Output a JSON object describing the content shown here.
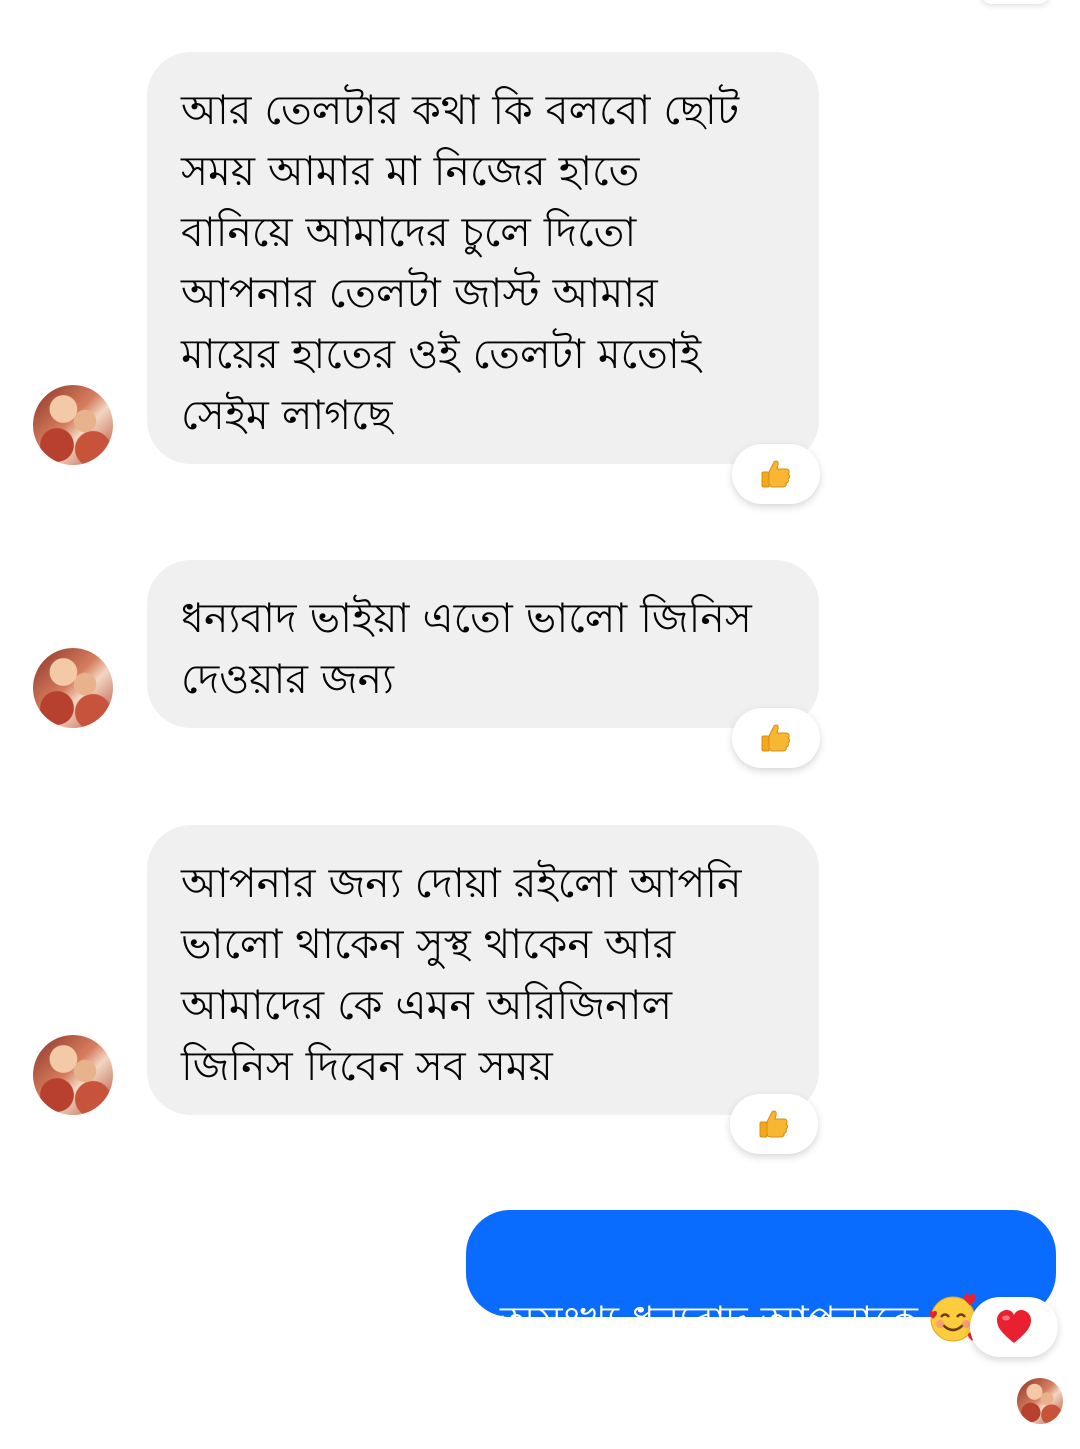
{
  "messages": [
    {
      "sender": "other",
      "text": "আর তেলটার কথা কি বলবো ছোট\nসময় আমার মা নিজের হাতে\nবানিয়ে আমাদের চুলে দিতো\nআপনার তেলটা জাস্ট আমার\nমায়ের হাতের ওই তেলটা মতোই\nসেইম লাগছে",
      "reaction": "thumbs-up"
    },
    {
      "sender": "other",
      "text": "ধন্যবাদ ভাইয়া এতো ভালো জিনিস\nদেওয়ার জন্য",
      "reaction": "thumbs-up"
    },
    {
      "sender": "other",
      "text": "আপনার জন্য দোয়া রইলো আপনি\nভালো থাকেন সুস্থ থাকেন আর\nআমাদের কে এমন অরিজিনাল\nজিনিস দিবেন সব সময়",
      "reaction": "thumbs-up"
    },
    {
      "sender": "me",
      "text": "অসংখ্য ধন্যবাদ আপনাকে",
      "emoji": "smiling-face-with-hearts",
      "reaction": "heart"
    }
  ],
  "colors": {
    "incoming_bubble": "#f0f0f0",
    "outgoing_bubble": "#0a6cff",
    "thumb": "#f7b733",
    "heart": "#e8202f"
  }
}
